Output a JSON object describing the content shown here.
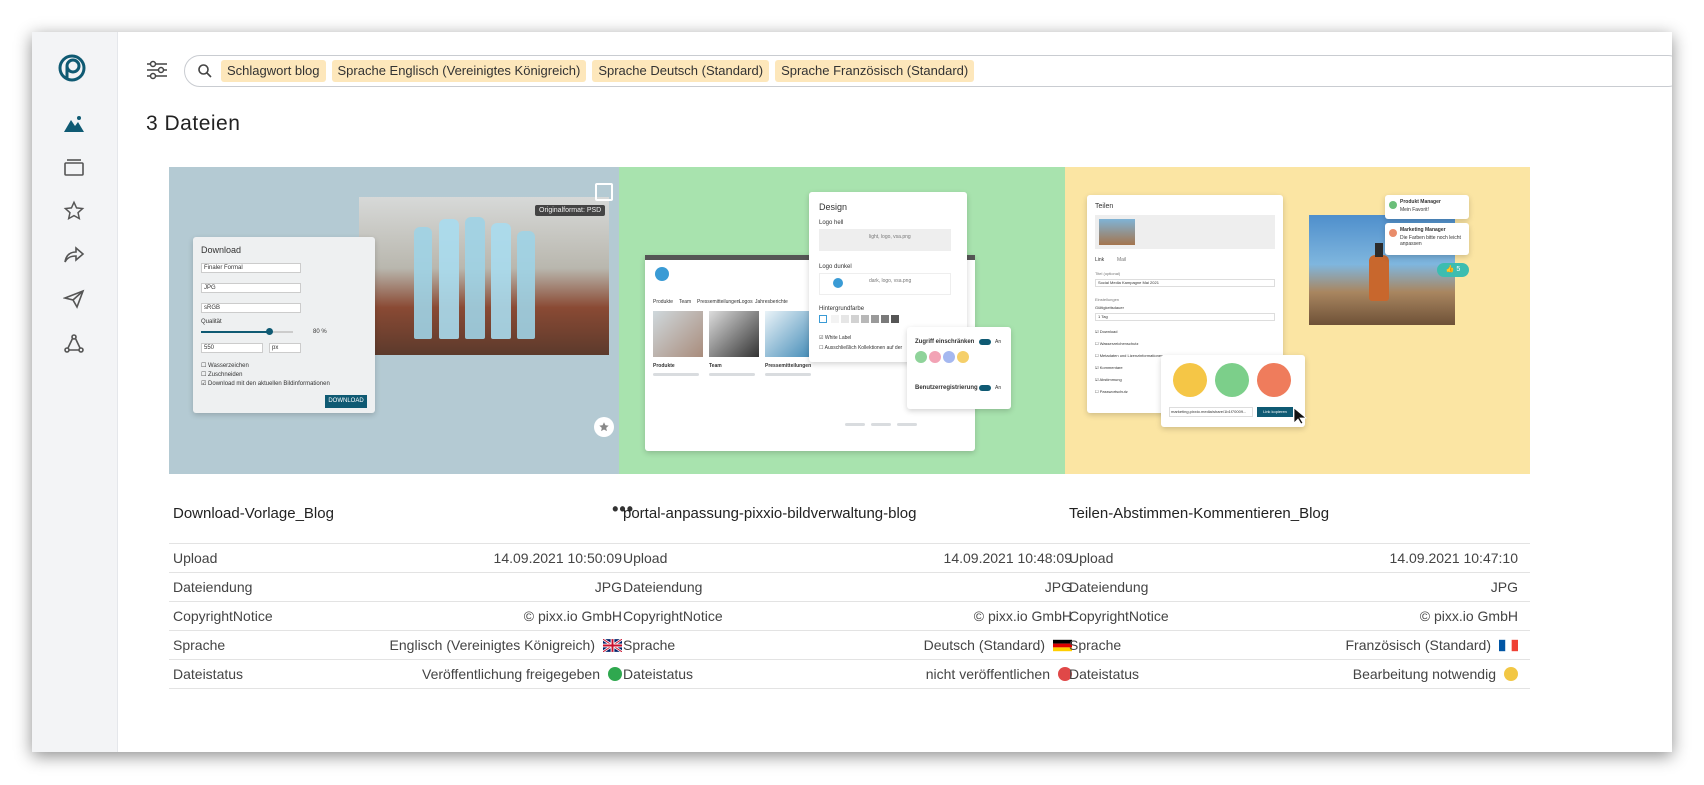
{
  "search": {
    "chips": [
      "Schlagwort blog",
      "Sprache Englisch (Vereinigtes Königreich)",
      "Sprache Deutsch (Standard)",
      "Sprache Französisch (Standard)"
    ]
  },
  "results": {
    "title": "3 Dateien"
  },
  "colors": {
    "accent": "#0f5a73",
    "chip": "#fde7bb"
  },
  "cards": [
    {
      "name": "Download-Vorlage_Blog",
      "thumb_bg": "#b4cad3",
      "badge": "Originalformat: PSD",
      "mock": {
        "dialog_title": "Download",
        "field1": "Finaler Formal",
        "field2": "JPG",
        "field3": "sRGB",
        "quality_label": "Qualität",
        "quality_value": "80 %",
        "width": "550",
        "unit": "px",
        "opt1": "Wasserzeichen",
        "opt2": "Zuschneiden",
        "opt3": "Download mit den aktuellen Bildinformationen",
        "download_btn": "DOWNLOAD"
      },
      "meta": [
        {
          "label": "Upload",
          "value": "14.09.2021 10:50:09"
        },
        {
          "label": "Dateiendung",
          "value": "JPG"
        },
        {
          "label": "CopyrightNotice",
          "value": "© pixx.io GmbH"
        },
        {
          "label": "Sprache",
          "value": "Englisch (Vereinigtes Königreich)",
          "flag": "uk-flag-icon"
        },
        {
          "label": "Dateistatus",
          "value": "Veröffentlichung freigegeben",
          "status_color": "#2fa84f"
        }
      ]
    },
    {
      "name": "portal-anpassung-pixxio-bildverwaltung-blog",
      "thumb_bg": "#a8e3ae",
      "mock": {
        "design_title": "Design",
        "logo_hell": "Logo hell",
        "logo_hell_hint": "light, logo, vsa.png",
        "logo_dunkel": "Logo dunkel",
        "logo_dunkel_hint": "dark, logo, vsa.png",
        "hintergrund": "Hintergrundfarbe",
        "white_label": "White Label",
        "nur_kollektionen": "Ausschließlich Kollektionen auf der",
        "zugriff": "Zugriff einschränken",
        "registrierung": "Benutzerregistrierung",
        "toggle_on": "An",
        "tabs": [
          "Produkte",
          "Team",
          "Pressemitteilungen",
          "Logos",
          "Jahresberichte"
        ],
        "cols": [
          "Produkte",
          "Team",
          "Pressemitteilungen"
        ]
      },
      "meta": [
        {
          "label": "Upload",
          "value": "14.09.2021 10:48:09"
        },
        {
          "label": "Dateiendung",
          "value": "JPG"
        },
        {
          "label": "CopyrightNotice",
          "value": "© pixx.io GmbH"
        },
        {
          "label": "Sprache",
          "value": "Deutsch (Standard)",
          "flag": "de-flag-icon"
        },
        {
          "label": "Dateistatus",
          "value": "nicht veröffentlichen",
          "status_color": "#e04848"
        }
      ]
    },
    {
      "name": "Teilen-Abstimmen-Kommentieren_Blog",
      "thumb_bg": "#fbe5a3",
      "mock": {
        "share_title": "Teilen",
        "tab_link": "Link",
        "tab_mail": "Mail",
        "titel_label": "Titel (optional)",
        "titel_value": "Social Media Kampagne Mai 2021",
        "einstellungen": "Einstellungen",
        "gueltig_label": "Gültigkeitsdauer",
        "gueltig_value": "1 Tag",
        "opts": [
          "Download",
          "Wasserzeichenschutz",
          "Metadaten und Lizenzinformationen",
          "Kommentare",
          "Abstimmung",
          "Passwortschutz"
        ],
        "link": "marketing.pixxio.media/share/1b1f70009...",
        "copy_btn": "Link kopieren",
        "comment1_name": "Produkt Manager",
        "comment1_text": "Mein Favorit!",
        "comment2_name": "Marketing Manager",
        "comment2_text": "Die Farben bitte noch leicht anpassen",
        "likes": "5"
      },
      "meta": [
        {
          "label": "Upload",
          "value": "14.09.2021 10:47:10"
        },
        {
          "label": "Dateiendung",
          "value": "JPG"
        },
        {
          "label": "CopyrightNotice",
          "value": "© pixx.io GmbH"
        },
        {
          "label": "Sprache",
          "value": "Französisch (Standard)",
          "flag": "fr-flag-icon"
        },
        {
          "label": "Dateistatus",
          "value": "Bearbeitung notwendig",
          "status_color": "#f2c744"
        }
      ]
    }
  ]
}
